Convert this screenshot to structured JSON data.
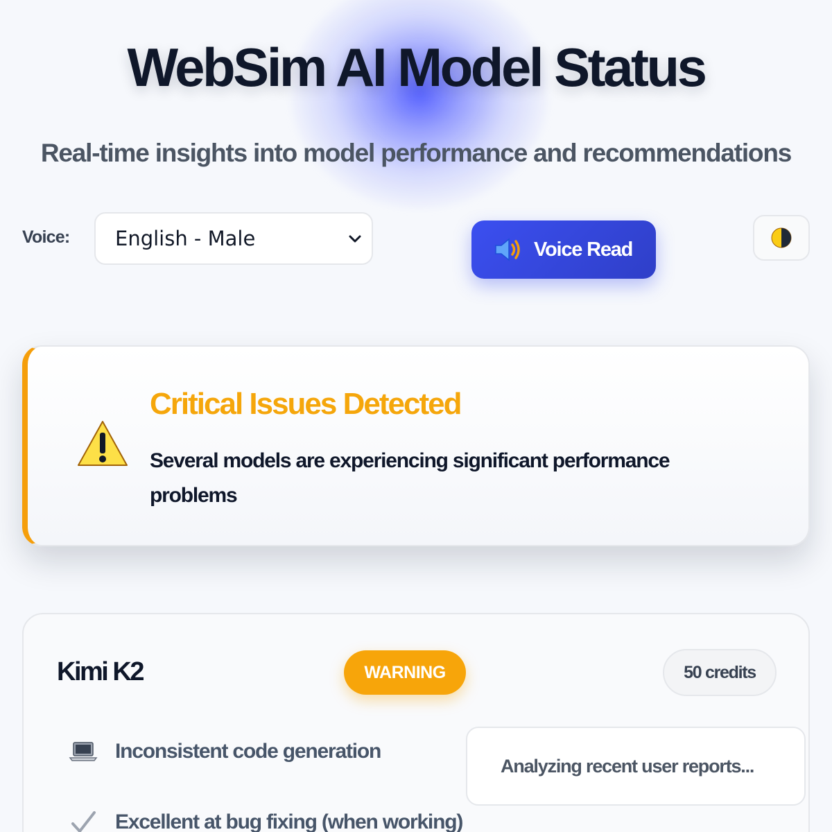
{
  "header": {
    "title": "WebSim AI Model Status",
    "subtitle": "Real-time insights into model performance and recommendations"
  },
  "controls": {
    "voice_label": "Voice:",
    "voice_select": {
      "selected": "English - Male"
    },
    "voice_read_button": {
      "label": "Voice Read",
      "icon": "speaker-icon"
    },
    "theme_toggle": {
      "icon": "half-moon-icon"
    }
  },
  "alert": {
    "icon": "warning-icon",
    "title": "Critical Issues Detected",
    "message": "Several models are experiencing significant performance problems",
    "accent_color": "#f59e0b"
  },
  "models": [
    {
      "name": "Kimi K2",
      "status": "WARNING",
      "status_color": "#f7a50a",
      "credits": "50 credits",
      "features": [
        {
          "icon": "laptop-icon",
          "text": "Inconsistent code generation"
        },
        {
          "icon": "checkmark-icon",
          "text": "Excellent at bug fixing (when working)"
        }
      ],
      "analysis": "Analyzing recent user reports..."
    }
  ],
  "colors": {
    "primary": "#3b4ff0",
    "warning": "#f59e0b",
    "background": "#f6f8fc"
  }
}
